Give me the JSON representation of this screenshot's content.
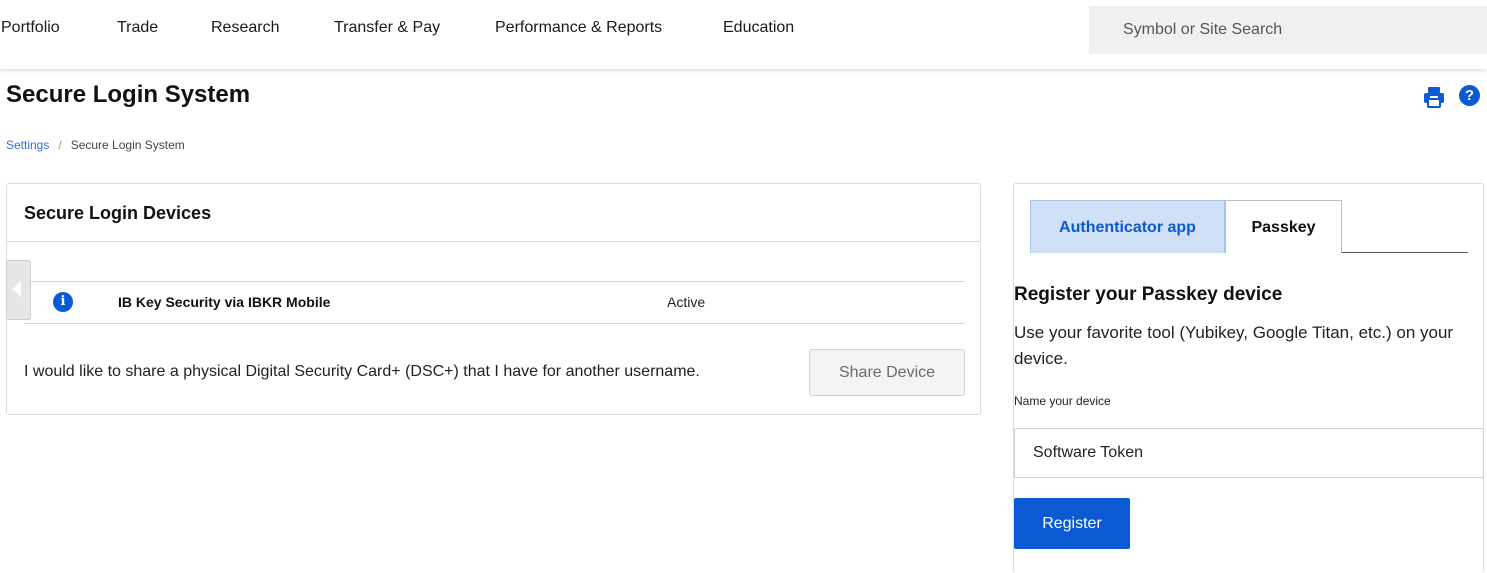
{
  "nav": {
    "items": [
      {
        "label": "Portfolio"
      },
      {
        "label": "Trade"
      },
      {
        "label": "Research"
      },
      {
        "label": "Transfer & Pay"
      },
      {
        "label": "Performance & Reports"
      },
      {
        "label": "Education"
      }
    ],
    "search_placeholder": "Symbol or Site Search"
  },
  "page": {
    "title": "Secure Login System",
    "icons": {
      "print": "print-icon",
      "help": "help-icon"
    },
    "help_glyph": "?"
  },
  "breadcrumb": {
    "parent": "Settings",
    "separator": "/",
    "current": "Secure Login System"
  },
  "devices": {
    "title": "Secure Login Devices",
    "rows": [
      {
        "icon": "info-icon",
        "icon_glyph": "i",
        "name": "IB Key Security via IBKR Mobile",
        "status": "Active"
      }
    ],
    "share_text": "I would like to share a physical Digital Security Card+ (DSC+) that I have for another username.",
    "share_button": "Share Device"
  },
  "passkey": {
    "tabs": [
      {
        "label": "Authenticator app",
        "active": false
      },
      {
        "label": "Passkey",
        "active": true
      }
    ],
    "section_title": "Register your Passkey device",
    "description": "Use your favorite tool (Yubikey, Google Titan, etc.) on your device.",
    "field_label": "Name your device",
    "field_value": "Software Token",
    "register_button": "Register"
  },
  "colors": {
    "accent": "#0a5bd3",
    "tab_active_bg": "#cfe0f7",
    "link": "#2c6fdc"
  }
}
